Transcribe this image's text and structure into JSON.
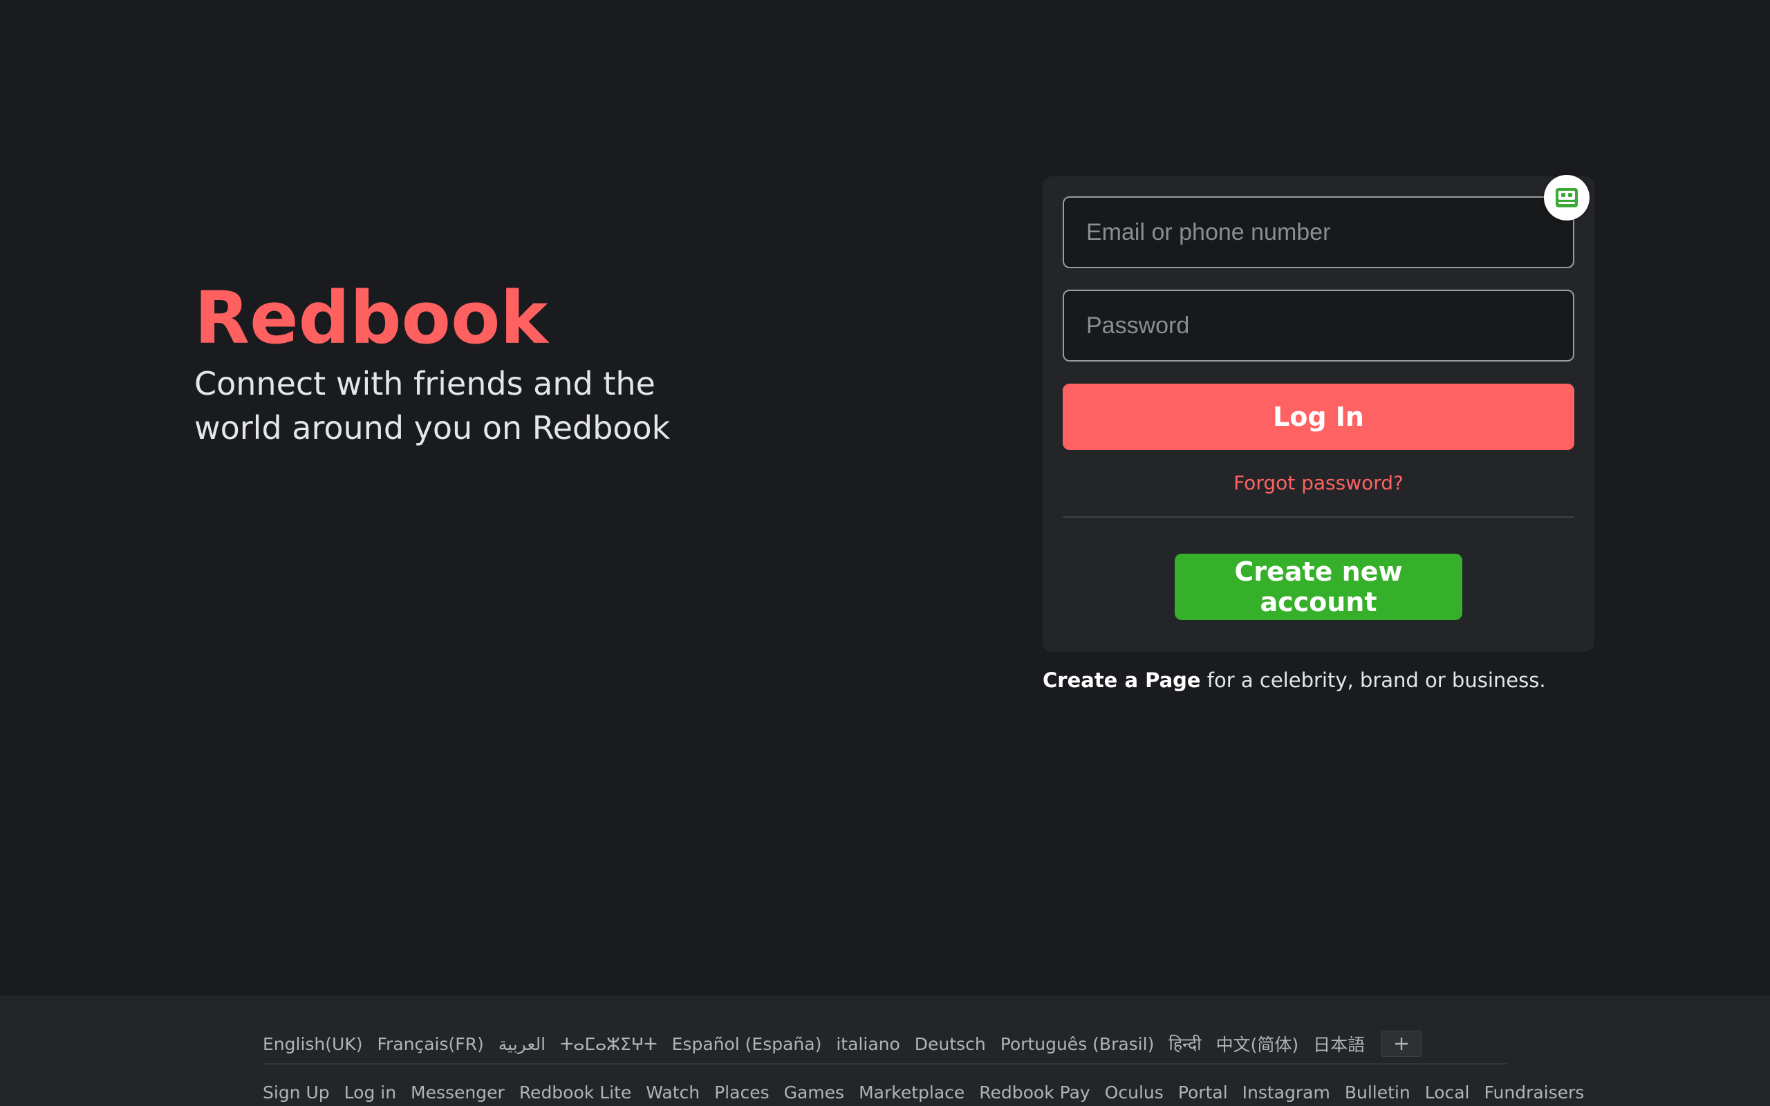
{
  "brand": {
    "name": "Redbook",
    "tagline": "Connect with friends and the world around you on Redbook"
  },
  "login": {
    "email_placeholder": "Email or phone number",
    "password_placeholder": "Password",
    "login_label": "Log In",
    "forgot_label": "Forgot password?",
    "create_account_label": "Create new account"
  },
  "create_page": {
    "link_text": "Create a Page",
    "rest_text": " for a celebrity, brand or business."
  },
  "extension": {
    "icon": "robot-extension-icon"
  },
  "footer": {
    "languages": [
      "English(UK)",
      "Français(FR)",
      "العربية",
      "ⵜⴰⵎⴰⵣⵉⵖⵜ",
      "Español (España)",
      "italiano",
      "Deutsch",
      "Português (Brasil)",
      "हिन्दी",
      "中文(简体)",
      "日本語"
    ],
    "more_languages_icon": "plus-icon",
    "links": [
      "Sign Up",
      "Log in",
      "Messenger",
      "Redbook Lite",
      "Watch",
      "Places",
      "Games",
      "Marketplace",
      "Redbook Pay",
      "Oculus",
      "Portal",
      "Instagram",
      "Bulletin",
      "Local",
      "Fundraisers"
    ]
  },
  "colors": {
    "background": "#1a1b1e",
    "card": "#242528",
    "accent": "#ff6262",
    "create_button": "#36b02a",
    "text": "#e4e6eb",
    "muted_text": "#b0b3b8"
  }
}
